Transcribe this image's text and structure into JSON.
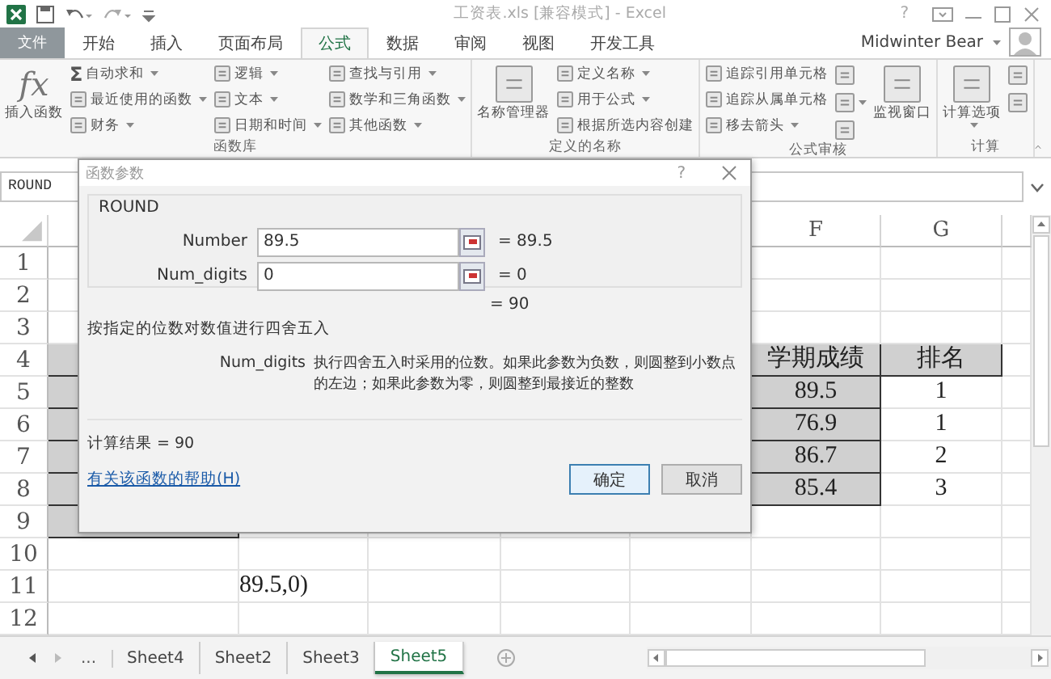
{
  "title_bar": {
    "title": "工资表.xls [兼容模式] - Excel",
    "help": "?"
  },
  "ribbon": {
    "file_tab": "文件",
    "user": "Midwinter Bear",
    "tabs": [
      {
        "label": "开始",
        "selected": false
      },
      {
        "label": "插入",
        "selected": false
      },
      {
        "label": "页面布局",
        "selected": false
      },
      {
        "label": "公式",
        "selected": true
      },
      {
        "label": "数据",
        "selected": false
      },
      {
        "label": "审阅",
        "selected": false
      },
      {
        "label": "视图",
        "selected": false
      },
      {
        "label": "开发工具",
        "selected": false
      }
    ],
    "groups": [
      {
        "label": "函数库",
        "columns": [
          [
            {
              "kind": "large",
              "glyph": "fx",
              "label": "插入函数",
              "dropdown": false
            }
          ],
          [
            {
              "kind": "small",
              "glyph": "Σ",
              "label": "自动求和",
              "dropdown": true
            },
            {
              "kind": "small",
              "label": "最近使用的函数",
              "dropdown": true
            },
            {
              "kind": "small",
              "label": "财务",
              "dropdown": true
            }
          ],
          [
            {
              "kind": "small",
              "label": "逻辑",
              "dropdown": true
            },
            {
              "kind": "small",
              "label": "文本",
              "dropdown": true
            },
            {
              "kind": "small",
              "label": "日期和时间",
              "dropdown": true
            }
          ],
          [
            {
              "kind": "small",
              "label": "查找与引用",
              "dropdown": true
            },
            {
              "kind": "small",
              "label": "数学和三角函数",
              "dropdown": true
            },
            {
              "kind": "small",
              "label": "其他函数",
              "dropdown": true
            }
          ]
        ]
      },
      {
        "label": "定义的名称",
        "columns": [
          [
            {
              "kind": "large",
              "label": "名称管理器",
              "dropdown": false
            }
          ],
          [
            {
              "kind": "small",
              "label": "定义名称",
              "dropdown": true
            },
            {
              "kind": "small",
              "label": "用于公式",
              "dropdown": true
            },
            {
              "kind": "small",
              "label": "根据所选内容创建",
              "dropdown": false
            }
          ]
        ]
      },
      {
        "label": "公式审核",
        "columns": [
          [
            {
              "kind": "small",
              "label": "追踪引用单元格",
              "dropdown": false
            },
            {
              "kind": "small",
              "label": "追踪从属单元格",
              "dropdown": false
            },
            {
              "kind": "small",
              "label": "移去箭头",
              "dropdown": true
            }
          ],
          [
            {
              "kind": "icon",
              "dropdown": false
            },
            {
              "kind": "icon",
              "dropdown": true
            },
            {
              "kind": "icon",
              "dropdown": false
            }
          ],
          [
            {
              "kind": "large",
              "label": "监视窗口",
              "dropdown": false
            }
          ]
        ]
      },
      {
        "label": "计算",
        "columns": [
          [
            {
              "kind": "large",
              "label": "计算选项",
              "dropdown": true
            }
          ],
          [
            {
              "kind": "icon",
              "dropdown": false
            },
            {
              "kind": "icon",
              "dropdown": false
            }
          ]
        ]
      }
    ]
  },
  "formula_bar": {
    "name_box": "ROUND"
  },
  "sheet": {
    "visible_columns": [
      "F",
      "G"
    ],
    "rows": [
      {
        "header": "1",
        "cells": {}
      },
      {
        "header": "2",
        "cells": {}
      },
      {
        "header": "3",
        "cells": {}
      },
      {
        "header": "4",
        "cells": {
          "A": {
            "shaded": true
          },
          "F": {
            "text": "学期成绩",
            "shaded": true
          },
          "G": {
            "text": "排名",
            "shaded": true
          }
        }
      },
      {
        "header": "5",
        "cells": {
          "A": {
            "shaded": true
          },
          "F": {
            "text": "89.5",
            "shaded": true
          },
          "G": {
            "text": "1",
            "shaded": false
          }
        }
      },
      {
        "header": "6",
        "cells": {
          "A": {
            "shaded": true
          },
          "F": {
            "text": "76.9",
            "shaded": true
          },
          "G": {
            "text": "1",
            "shaded": false
          }
        }
      },
      {
        "header": "7",
        "cells": {
          "A": {
            "shaded": true
          },
          "F": {
            "text": "86.7",
            "shaded": true
          },
          "G": {
            "text": "2",
            "shaded": false
          }
        }
      },
      {
        "header": "8",
        "cells": {
          "A": {
            "shaded": true
          },
          "F": {
            "text": "85.4",
            "shaded": true
          },
          "G": {
            "text": "3",
            "shaded": false
          }
        }
      },
      {
        "header": "9",
        "cells": {
          "A": {
            "shaded": true
          }
        }
      },
      {
        "header": "10",
        "cells": {}
      },
      {
        "header": "11",
        "cells": {
          "B": {
            "text": "89.5,0)",
            "shaded": false
          }
        }
      },
      {
        "header": "12",
        "cells": {}
      }
    ]
  },
  "sheet_tabs": {
    "overflow": "...",
    "tabs": [
      {
        "label": "Sheet4",
        "selected": false
      },
      {
        "label": "Sheet2",
        "selected": false
      },
      {
        "label": "Sheet3",
        "selected": false
      },
      {
        "label": "Sheet5",
        "selected": true
      }
    ]
  },
  "dialog": {
    "title": "函数参数",
    "help": "?",
    "function_name": "ROUND",
    "arguments": [
      {
        "label": "Number",
        "value": "89.5",
        "result": "= 89.5"
      },
      {
        "label": "Num_digits",
        "value": "0",
        "result": "= 0"
      }
    ],
    "formula_result": "= 90",
    "description": "按指定的位数对数值进行四舍五入",
    "argument_help": {
      "label": "Num_digits",
      "text": "执行四舍五入时采用的位数。如果此参数为负数，则圆整到小数点的左边；如果此参数为零，则圆整到最接近的整数"
    },
    "calculation_result": "计算结果 =  90",
    "help_link": "有关该函数的帮助(H)",
    "buttons": [
      {
        "label": "确定",
        "default": true
      },
      {
        "label": "取消",
        "default": false
      }
    ]
  }
}
